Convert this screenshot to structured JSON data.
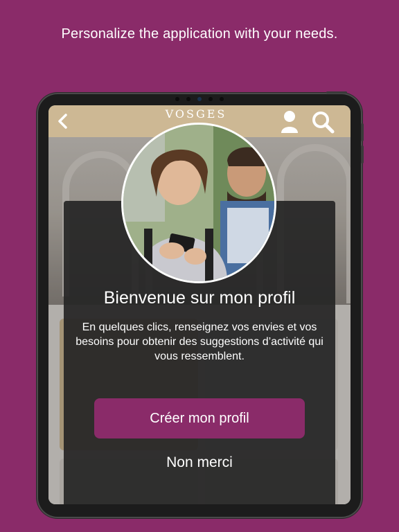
{
  "headline": "Personalize the application with your needs.",
  "appbar": {
    "brand": "VOSGES",
    "back_icon": "chevron-left-icon",
    "user_icon": "user-icon",
    "search_icon": "search-icon"
  },
  "dialog": {
    "title": "Bienvenue sur mon profil",
    "description": "En quelques clics, renseignez vos envies et vos besoins pour obtenir des suggestions d’activité qui vous ressemblent.",
    "primary_button": "Créer mon profil",
    "secondary_button": "Non merci"
  },
  "colors": {
    "background": "#8a2b69",
    "accent": "#8a2b69",
    "appbar": "#cdb894"
  }
}
